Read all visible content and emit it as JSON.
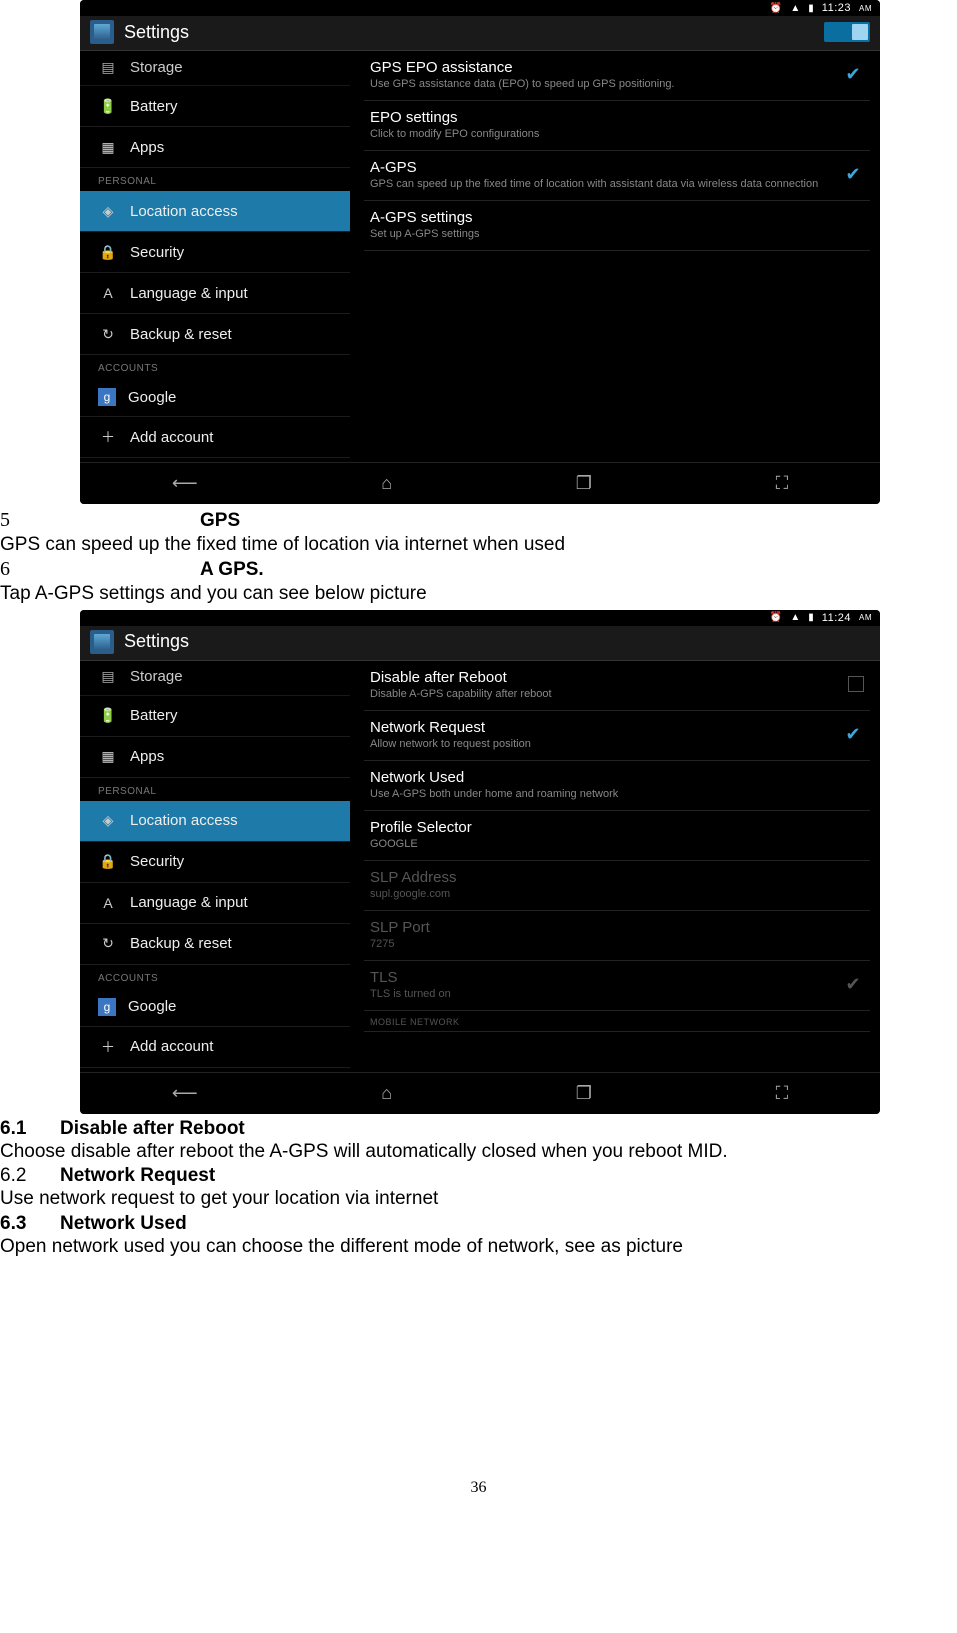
{
  "page_number": "36",
  "shot1": {
    "status_time": "11:23",
    "status_ampm": "AM",
    "app_title": "Settings",
    "sidebar": {
      "storage": "Storage",
      "battery": "Battery",
      "apps": "Apps",
      "hdr_personal": "PERSONAL",
      "location": "Location access",
      "security": "Security",
      "language": "Language & input",
      "backup": "Backup & reset",
      "hdr_accounts": "ACCOUNTS",
      "google": "Google",
      "add": "Add account"
    },
    "rows": {
      "r1_t": "GPS EPO assistance",
      "r1_s": "Use GPS assistance data (EPO) to speed up GPS positioning.",
      "r2_t": "EPO settings",
      "r2_s": "Click to modify EPO configurations",
      "r3_t": "A-GPS",
      "r3_s": "GPS can speed up the fixed time of location with assistant data via wireless data connection",
      "r4_t": "A-GPS settings",
      "r4_s": "Set up A-GPS settings"
    }
  },
  "doc": {
    "item5_n": "5",
    "item5_t": "GPS",
    "item5_body": "GPS can speed up the fixed time of location via internet when used",
    "item6_n": "6",
    "item6_t": "A GPS.",
    "item6_body": "Tap A-GPS settings and you can see below picture",
    "s61_n": "6.1",
    "s61_t": "Disable after Reboot",
    "s61_b": "Choose disable after reboot the A-GPS will automatically closed when you reboot MID.",
    "s62_n": "6.2",
    "s62_t": "Network Request",
    "s62_b": "Use network request to get your location via internet",
    "s63_n": "6.3",
    "s63_t": "Network Used",
    "s63_b": "Open network used you can choose the different mode of network, see as picture"
  },
  "shot2": {
    "status_time": "11:24",
    "status_ampm": "AM",
    "app_title": "Settings",
    "rows": {
      "r1_t": "Disable after Reboot",
      "r1_s": "Disable A-GPS capability after reboot",
      "r2_t": "Network Request",
      "r2_s": "Allow network to request position",
      "r3_t": "Network Used",
      "r3_s": "Use A-GPS both under home and roaming network",
      "r4_t": "Profile Selector",
      "r4_s": "GOOGLE",
      "r5_t": "SLP Address",
      "r5_s": "supl.google.com",
      "r6_t": "SLP Port",
      "r6_s": "7275",
      "r7_t": "TLS",
      "r7_s": "TLS is turned on",
      "r8_t": "MOBILE NETWORK"
    }
  }
}
